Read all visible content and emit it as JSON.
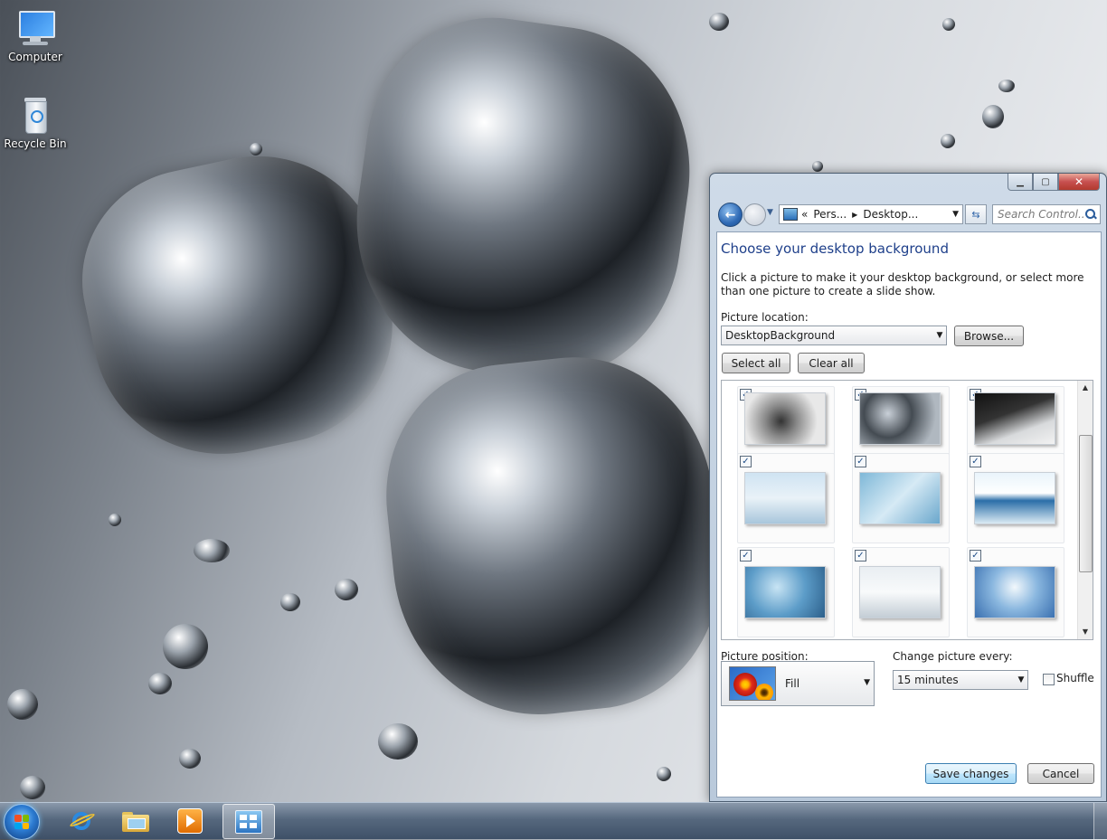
{
  "desktop": {
    "icons": [
      {
        "label": "Computer",
        "icon": "computer-icon"
      },
      {
        "label": "Recycle Bin",
        "icon": "recycle-bin-icon"
      }
    ]
  },
  "taskbar": {
    "items": [
      {
        "name": "start-button",
        "icon": "windows-logo-icon"
      },
      {
        "name": "internet-explorer",
        "icon": "internet-explorer-icon"
      },
      {
        "name": "windows-explorer",
        "icon": "folder-icon"
      },
      {
        "name": "media-player",
        "icon": "media-player-icon"
      },
      {
        "name": "control-panel",
        "icon": "control-panel-icon",
        "active": true
      }
    ]
  },
  "window": {
    "address": {
      "prefix": "«",
      "segments": [
        "Pers...",
        "Desktop..."
      ]
    },
    "search_placeholder": "Search Control...",
    "heading": "Choose your desktop background",
    "description": "Click a picture to make it your desktop background, or select more than one picture to create a slide show.",
    "picture_location_label": "Picture location:",
    "picture_location_value": "DesktopBackground",
    "browse_label": "Browse...",
    "select_all_label": "Select all",
    "clear_all_label": "Clear all",
    "thumbnails": [
      {
        "checked": true
      },
      {
        "checked": true
      },
      {
        "checked": true
      },
      {
        "checked": true
      },
      {
        "checked": true
      },
      {
        "checked": true
      },
      {
        "checked": true
      },
      {
        "checked": true
      },
      {
        "checked": true
      }
    ],
    "picture_position_label": "Picture position:",
    "picture_position_value": "Fill",
    "change_every_label": "Change picture every:",
    "change_every_value": "15 minutes",
    "shuffle_label": "Shuffle",
    "shuffle_checked": false,
    "save_label": "Save changes",
    "cancel_label": "Cancel"
  },
  "colors": {
    "heading": "#1e3f8a",
    "close_button": "#c75050",
    "taskbar": "#56687e"
  }
}
